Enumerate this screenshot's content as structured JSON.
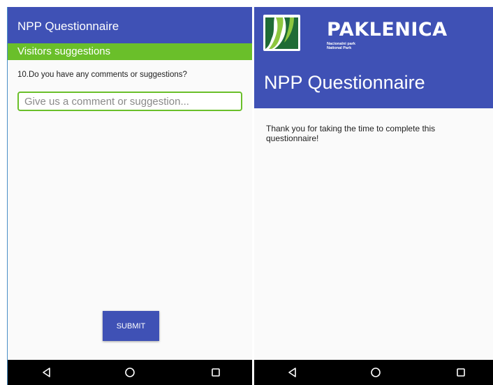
{
  "left": {
    "app_title": "NPP Questionnaire",
    "section_title": "Visitors suggestions",
    "question": "10.Do you have any comments or suggestions?",
    "comment_input": {
      "placeholder": "Give us a comment or suggestion...",
      "value": ""
    },
    "submit_label": "SUBMIT"
  },
  "right": {
    "brand": {
      "name": "PAKLENICA",
      "subtitle_line1": "Nacionalni park",
      "subtitle_line2": "National Park"
    },
    "app_title": "NPP Questionnaire",
    "thanks_message": "Thank you for taking the time to complete this questionnaire!"
  },
  "navbar": {
    "icons": [
      "back-icon",
      "home-icon",
      "recents-icon"
    ]
  },
  "colors": {
    "primary": "#3f51b5",
    "accent_green": "#6abf2a",
    "logo_dark_green": "#1f6b35",
    "logo_light_green": "#8dc63f",
    "navbar": "#000000"
  }
}
